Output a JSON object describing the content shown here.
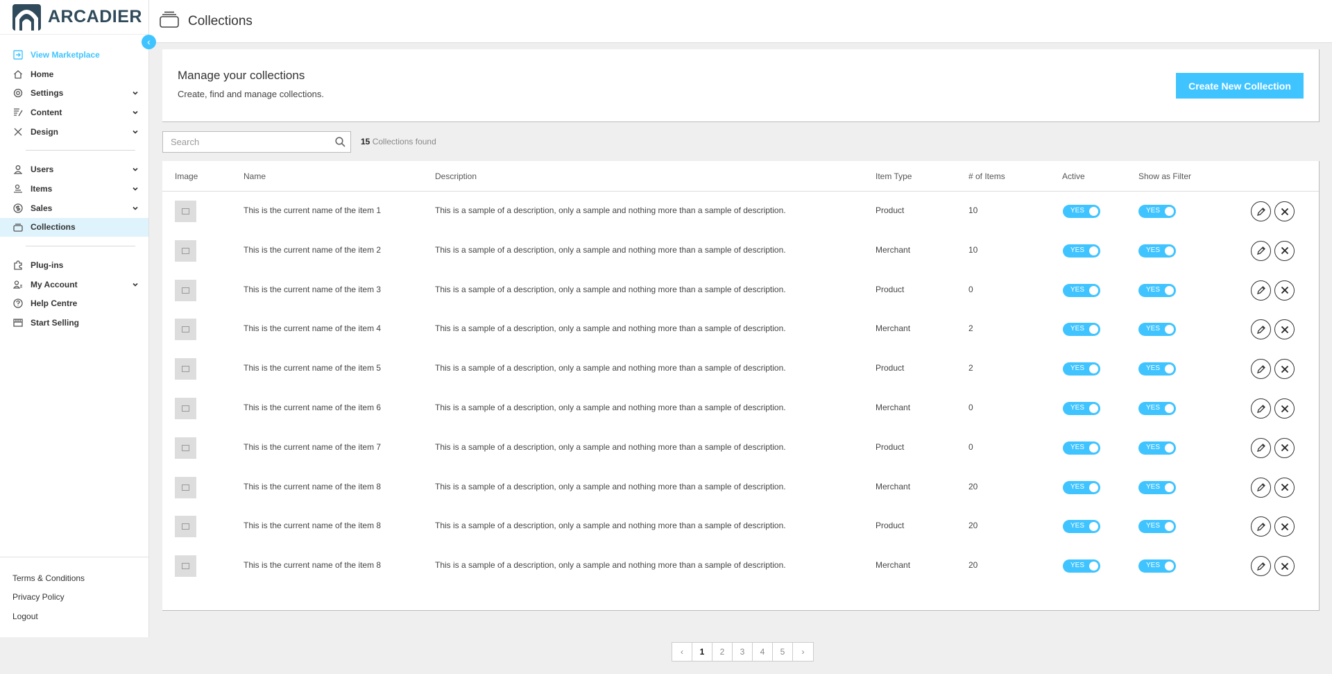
{
  "brand": {
    "name": "ARCADIER"
  },
  "header": {
    "title": "Collections",
    "icon": "collections-icon"
  },
  "sidebar": {
    "items": [
      {
        "label": "View Marketplace",
        "icon": "external-link-icon",
        "chevron": false,
        "link": true
      },
      {
        "label": "Home",
        "icon": "home-icon",
        "chevron": false
      },
      {
        "label": "Settings",
        "icon": "gear-icon",
        "chevron": true
      },
      {
        "label": "Content",
        "icon": "content-icon",
        "chevron": true
      },
      {
        "label": "Design",
        "icon": "design-tools-icon",
        "chevron": true
      },
      {
        "label": "Users",
        "icon": "user-icon",
        "chevron": true
      },
      {
        "label": "Items",
        "icon": "items-icon",
        "chevron": true
      },
      {
        "label": "Sales",
        "icon": "dollar-icon",
        "chevron": true
      },
      {
        "label": "Collections",
        "icon": "collections-icon",
        "chevron": false,
        "active": true
      },
      {
        "label": "Plug-ins",
        "icon": "puzzle-icon",
        "chevron": false
      },
      {
        "label": "My Account",
        "icon": "account-icon",
        "chevron": true
      },
      {
        "label": "Help Centre",
        "icon": "help-icon",
        "chevron": false
      },
      {
        "label": "Start Selling",
        "icon": "store-icon",
        "chevron": false
      }
    ],
    "footer": [
      "Terms & Conditions",
      "Privacy Policy",
      "Logout"
    ]
  },
  "manage": {
    "title": "Manage your collections",
    "subtitle": "Create, find and manage collections.",
    "create_label": "Create New Collection"
  },
  "search": {
    "placeholder": "Search",
    "count": "15",
    "count_suffix": "Collections found"
  },
  "table": {
    "headers": [
      "Image",
      "Name",
      "Description",
      "Item Type",
      "# of Items",
      "Active",
      "Show as Filter"
    ],
    "rows": [
      {
        "name": "This is the current name of the item 1",
        "description": "This is a sample of a description, only a sample and nothing more than a sample of description.",
        "type": "Product",
        "count": "10",
        "active": "YES",
        "filter": "YES"
      },
      {
        "name": "This is the current name of the item 2",
        "description": "This is a sample of a description, only a sample and nothing more than a sample of description.",
        "type": "Merchant",
        "count": "10",
        "active": "YES",
        "filter": "YES"
      },
      {
        "name": "This is the current name of the item 3",
        "description": "This is a sample of a description, only a sample and nothing more than a sample of description.",
        "type": "Product",
        "count": "0",
        "active": "YES",
        "filter": "YES"
      },
      {
        "name": "This is the current name of the item 4",
        "description": "This is a sample of a description, only a sample and nothing more than a sample of description.",
        "type": "Merchant",
        "count": "2",
        "active": "YES",
        "filter": "YES"
      },
      {
        "name": "This is the current name of the item 5",
        "description": "This is a sample of a description, only a sample and nothing more than a sample of description.",
        "type": "Product",
        "count": "2",
        "active": "YES",
        "filter": "YES"
      },
      {
        "name": "This is the current name of the item 6",
        "description": "This is a sample of a description, only a sample and nothing more than a sample of description.",
        "type": "Merchant",
        "count": "0",
        "active": "YES",
        "filter": "YES"
      },
      {
        "name": "This is the current name of the item 7",
        "description": "This is a sample of a description, only a sample and nothing more than a sample of description.",
        "type": "Product",
        "count": "0",
        "active": "YES",
        "filter": "YES"
      },
      {
        "name": "This is the current name of the item 8",
        "description": "This is a sample of a description, only a sample and nothing more than a sample of description.",
        "type": "Merchant",
        "count": "20",
        "active": "YES",
        "filter": "YES"
      },
      {
        "name": "This is the current name of the item 8",
        "description": "This is a sample of a description, only a sample and nothing more than a sample of description.",
        "type": "Product",
        "count": "20",
        "active": "YES",
        "filter": "YES"
      },
      {
        "name": "This is the current name of the item 8",
        "description": "This is a sample of a description, only a sample and nothing more than a sample of description.",
        "type": "Merchant",
        "count": "20",
        "active": "YES",
        "filter": "YES"
      }
    ]
  },
  "pagination": {
    "prev": "‹",
    "pages": [
      "1",
      "2",
      "3",
      "4",
      "5"
    ],
    "current": "1",
    "next": "›"
  },
  "colors": {
    "accent": "#40c4ff",
    "brand": "#2f4a5a",
    "active_bg": "#dff3fc"
  }
}
